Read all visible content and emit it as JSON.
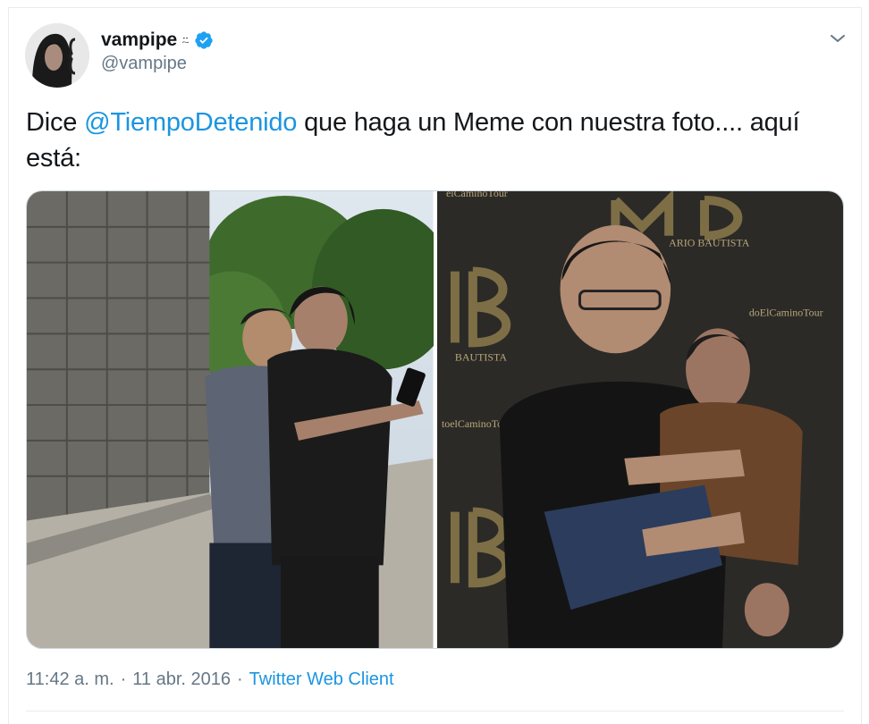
{
  "user": {
    "display_name": "vampipe",
    "emoji": " ⍨",
    "handle": "@vampipe",
    "verified": true
  },
  "tweet": {
    "text_before": "Dice ",
    "mention": "@TiempoDetenido",
    "text_after": " que haga un Meme con nuestra foto.... aquí está:"
  },
  "media": {
    "photos": [
      {
        "icon": "photo-selfie"
      },
      {
        "icon": "photo-meme"
      }
    ]
  },
  "meta": {
    "time": "11:42 a. m.",
    "separator": "·",
    "date": "11 abr. 2016",
    "source": "Twitter Web Client"
  },
  "colors": {
    "link": "#1b95e0",
    "secondary_text": "#657786",
    "verified": "#1da1f2"
  }
}
